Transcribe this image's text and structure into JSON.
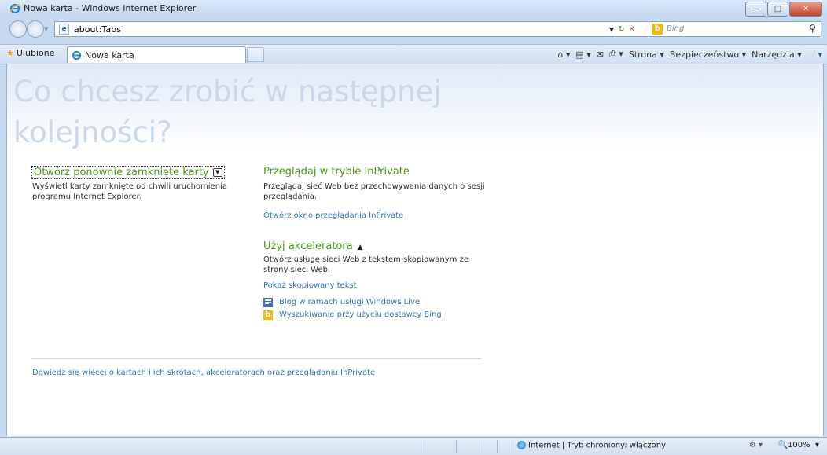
{
  "window": {
    "title": "Nowa karta - Windows Internet Explorer"
  },
  "address": {
    "url": "about:Tabs",
    "search_placeholder": "Bing"
  },
  "tabs": {
    "favorites_label": "Ulubione",
    "active_tab": "Nowa karta"
  },
  "commandbar": {
    "page": "Strona",
    "security": "Bezpieczeństwo",
    "tools": "Narzędzia"
  },
  "content": {
    "heading": "Co chcesz zrobić w następnej kolejności?",
    "reopen_title": "Otwórz ponownie zamknięte karty",
    "reopen_desc": "Wyświetl karty zamknięte od chwili uruchomienia programu Internet Explorer.",
    "inprivate_title": "Przeglądaj w trybie InPrivate",
    "inprivate_desc": "Przeglądaj sieć Web bez przechowywania danych o sesji przeglądania.",
    "inprivate_link": "Otwórz okno przeglądania InPrivate",
    "accelerator_title": "Użyj akceleratora",
    "accelerator_desc": "Otwórz usługę sieci Web z tekstem skopiowanym ze strony sieci Web.",
    "show_copied_link": "Pokaż skopiowany tekst",
    "accelerator_items": [
      "Blog w ramach usługi Windows Live",
      "Wyszukiwanie przy użyciu dostawcy Bing"
    ],
    "learn_more_link": "Dowiedz się więcej o kartach i ich skrótach, akceleratorach oraz przeglądaniu InPrivate"
  },
  "status": {
    "zone": "Internet | Tryb chroniony: włączony",
    "zoom": "100%"
  }
}
